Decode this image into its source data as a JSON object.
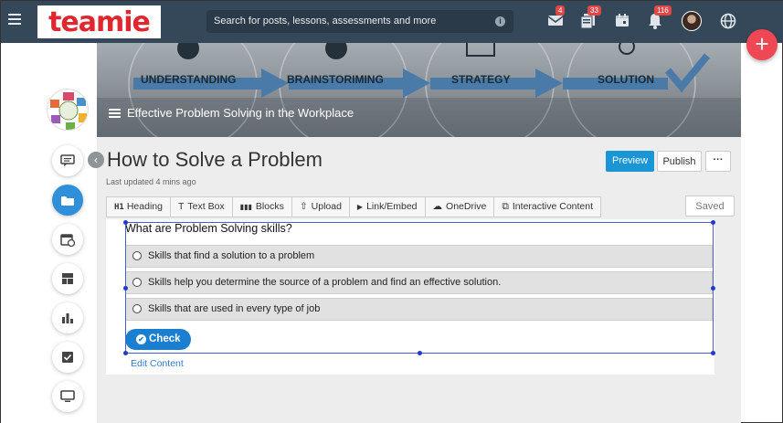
{
  "topbar": {
    "logo_text": "teamie",
    "search_placeholder": "Search for posts, lessons, assessments and more",
    "info_glyph": "i",
    "badges": {
      "messages": "4",
      "posts": "33",
      "notifications": "116"
    }
  },
  "fab": {
    "label": "+"
  },
  "banner": {
    "steps": [
      "UNDERSTANDING",
      "BRAINSTORIMING",
      "STRATEGY",
      "SOLUTION"
    ],
    "course_title": "Effective Problem Solving in the Workplace"
  },
  "page": {
    "title": "How to Solve a Problem",
    "updated": "Last updated 4 mins ago",
    "collapse_glyph": "‹"
  },
  "actions": {
    "preview": "Preview",
    "publish": "Publish",
    "more": "···",
    "saved": "Saved"
  },
  "toolbar": {
    "items": [
      {
        "icon": "H1",
        "label": "Heading"
      },
      {
        "icon": "T",
        "label": "Text Box"
      },
      {
        "icon": "▮▮▮",
        "label": "Blocks"
      },
      {
        "icon": "⇧",
        "label": "Upload"
      },
      {
        "icon": "▶",
        "label": "Link/Embed"
      },
      {
        "icon": "☁",
        "label": "OneDrive"
      },
      {
        "icon": "⧉",
        "label": "Interactive Content"
      }
    ]
  },
  "quiz": {
    "question": "What are Problem Solving skills?",
    "options": [
      "Skills that find a solution to a problem",
      "Skills help you determine the source of a problem and find an effective solution.",
      "Skills that are used in every type of job"
    ],
    "check_label": "Check",
    "check_glyph": "✔"
  },
  "edit_link": "Edit Content",
  "colors": {
    "topbar": "#35485a",
    "accent": "#1a95d6",
    "fab": "#ef4854",
    "badge": "#e04848"
  }
}
